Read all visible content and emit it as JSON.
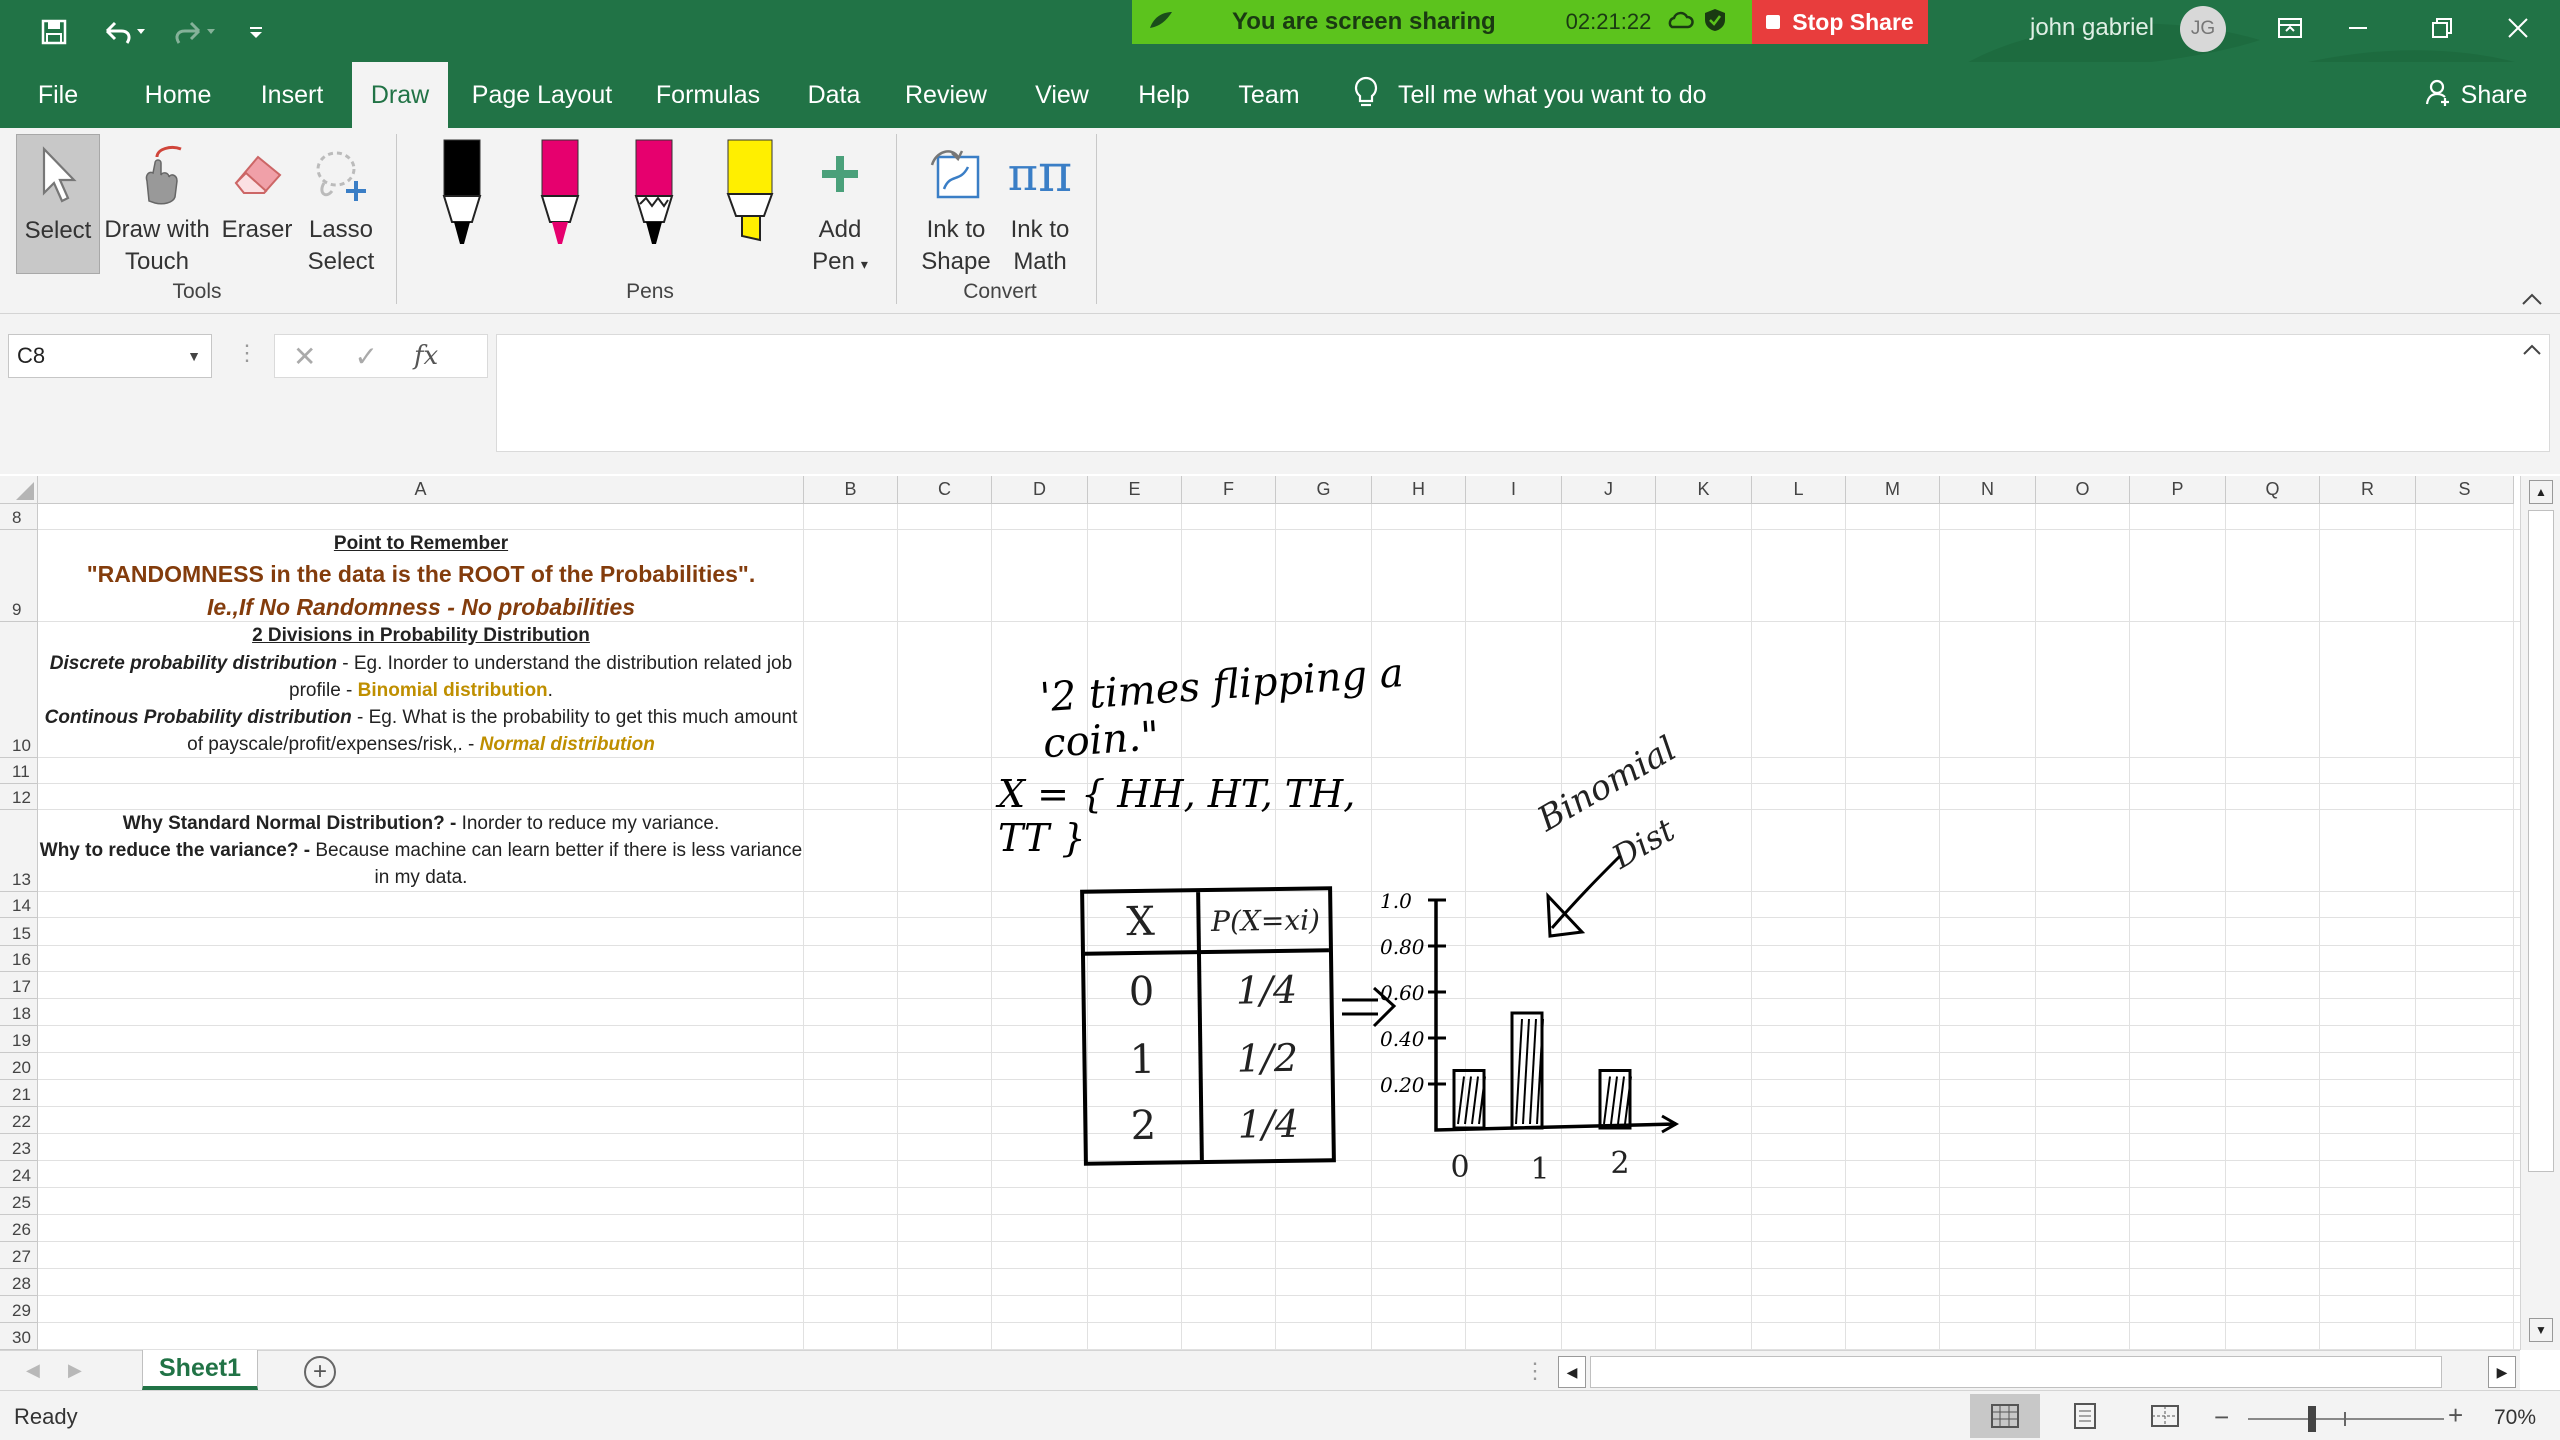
{
  "titlebar": {
    "sharing_text": "You are screen sharing",
    "sharing_time": "02:21:22",
    "stop_share": "Stop Share",
    "user_name": "john gabriel",
    "user_initials": "JG",
    "colors": {
      "excel_green": "#217346",
      "sharing_green": "#5cc31d",
      "stop_red": "#e83d3d"
    }
  },
  "tabs": [
    "File",
    "Home",
    "Insert",
    "Draw",
    "Page Layout",
    "Formulas",
    "Data",
    "Review",
    "View",
    "Help",
    "Team"
  ],
  "active_tab": "Draw",
  "tell_me": "Tell me what you want to do",
  "share_label": "Share",
  "ribbon": {
    "tools": {
      "select": "Select",
      "draw_touch_1": "Draw with",
      "draw_touch_2": "Touch",
      "eraser": "Eraser",
      "lasso_1": "Lasso",
      "lasso_2": "Select",
      "group": "Tools"
    },
    "pens": {
      "add_pen_1": "Add",
      "add_pen_2": "Pen",
      "group": "Pens",
      "pen_colors": [
        "#000000",
        "#e6006e",
        "#e6006e",
        "#ffef00"
      ]
    },
    "convert": {
      "ink_shape_1": "Ink to",
      "ink_shape_2": "Shape",
      "ink_math_1": "Ink to",
      "ink_math_2": "Math",
      "group": "Convert"
    }
  },
  "formula_bar": {
    "name_box": "C8",
    "fx": "fx",
    "content": ""
  },
  "columns": [
    "A",
    "B",
    "C",
    "D",
    "E",
    "F",
    "G",
    "H",
    "I",
    "J",
    "K",
    "L",
    "M",
    "N",
    "O",
    "P",
    "Q",
    "R",
    "S"
  ],
  "rows": [
    "8",
    "9",
    "10",
    "11",
    "12",
    "13",
    "14",
    "15",
    "16",
    "17",
    "18",
    "19",
    "20",
    "21",
    "22",
    "23",
    "24",
    "25",
    "26",
    "27",
    "28",
    "29",
    "30"
  ],
  "cells": {
    "point_title": "Point to Remember",
    "randomness": "\"RANDOMNESS in the data is the ROOT of the Probabilities\".",
    "no_randomness": "Ie.,If No Randomness - No probabilities",
    "divisions": "2 Divisions in Probability Distribution",
    "discrete_bold": "Discrete probability distribution",
    "discrete_rest": " - Eg. Inorder to understand the distribution related job",
    "discrete_line2": "profile - ",
    "binomial": "Binomial distribution",
    "continuous_bold": "Continous Probability distribution",
    "continuous_rest": " - Eg. What is the probability to get this much amount",
    "continuous_line2": "of payscale/profit/expenses/risk,. - ",
    "normal": "Normal distribution",
    "why_snd_bold": "Why Standard Normal Distribution? - ",
    "why_snd_rest": "Inorder to reduce my variance.",
    "why_var_bold": "Why to reduce the variance? - ",
    "why_var_rest": "Because machine can learn better if there is less variance",
    "why_var_line2": "in my data."
  },
  "ink": {
    "title": "'2 times flipping a coin.\"",
    "set": "X = { HH, HT, TH, TT }",
    "table_header": [
      "X",
      "P(X=xi)"
    ],
    "table_rows": [
      [
        "0",
        "1/4"
      ],
      [
        "1",
        "1/2"
      ],
      [
        "2",
        "1/4"
      ]
    ],
    "y_ticks": [
      "1.0",
      "0.80",
      "0.60",
      "0.40",
      "0.20"
    ],
    "x_ticks": [
      "0",
      "1",
      "2"
    ],
    "annotation_1": "Binomial",
    "annotation_2": "Dist"
  },
  "sheet_tab": "Sheet1",
  "status": {
    "ready": "Ready",
    "zoom": "70%"
  }
}
